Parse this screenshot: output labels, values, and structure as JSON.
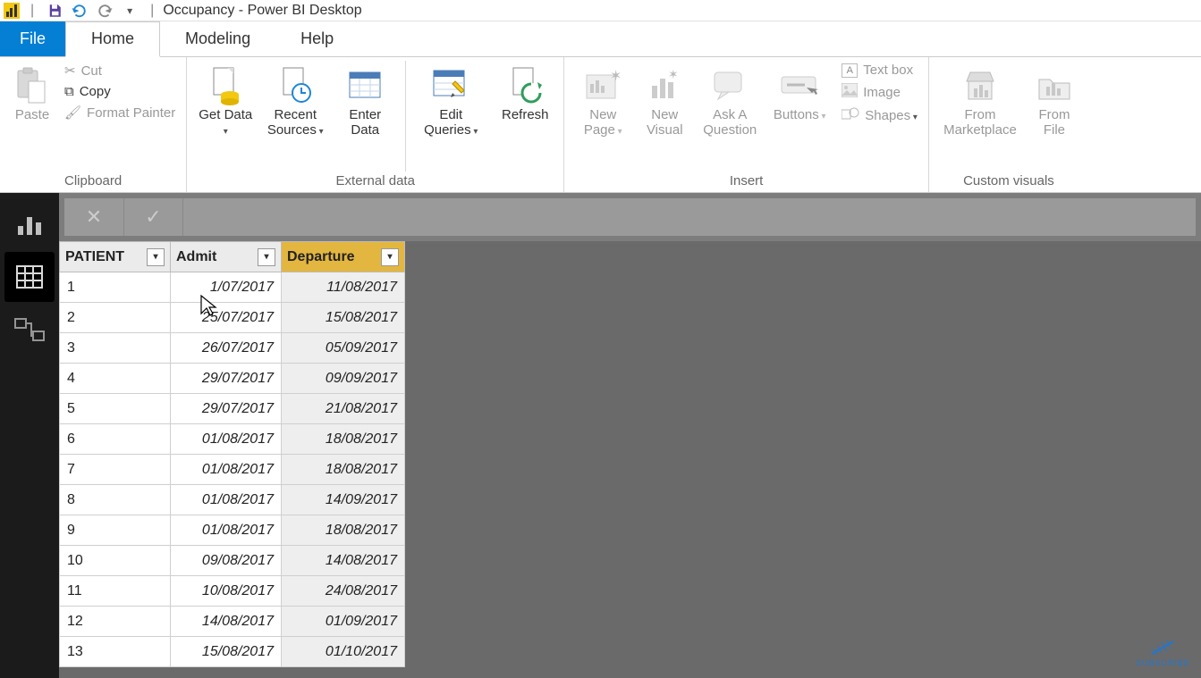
{
  "titlebar": {
    "window_title": "Occupancy - Power BI Desktop"
  },
  "menu": {
    "file": "File",
    "home": "Home",
    "modeling": "Modeling",
    "help": "Help"
  },
  "ribbon": {
    "clipboard": {
      "label": "Clipboard",
      "paste": "Paste",
      "cut": "Cut",
      "copy": "Copy",
      "format_painter": "Format Painter"
    },
    "external_data": {
      "label": "External data",
      "get_data": "Get Data",
      "recent_sources": "Recent Sources",
      "enter_data": "Enter Data",
      "edit_queries": "Edit Queries",
      "refresh": "Refresh"
    },
    "insert": {
      "label": "Insert",
      "new_page": "New Page",
      "new_visual": "New Visual",
      "ask_a_question": "Ask A Question",
      "buttons": "Buttons",
      "text_box": "Text box",
      "image": "Image",
      "shapes": "Shapes"
    },
    "custom_visuals": {
      "label": "Custom visuals",
      "from_marketplace": "From Marketplace",
      "from_file": "From File"
    }
  },
  "table": {
    "columns": {
      "patient": "PATIENT",
      "admit": "Admit",
      "departure": "Departure"
    },
    "rows": [
      {
        "patient": "1",
        "admit": "1/07/2017",
        "departure": "11/08/2017"
      },
      {
        "patient": "2",
        "admit": "25/07/2017",
        "departure": "15/08/2017"
      },
      {
        "patient": "3",
        "admit": "26/07/2017",
        "departure": "05/09/2017"
      },
      {
        "patient": "4",
        "admit": "29/07/2017",
        "departure": "09/09/2017"
      },
      {
        "patient": "5",
        "admit": "29/07/2017",
        "departure": "21/08/2017"
      },
      {
        "patient": "6",
        "admit": "01/08/2017",
        "departure": "18/08/2017"
      },
      {
        "patient": "7",
        "admit": "01/08/2017",
        "departure": "18/08/2017"
      },
      {
        "patient": "8",
        "admit": "01/08/2017",
        "departure": "14/09/2017"
      },
      {
        "patient": "9",
        "admit": "01/08/2017",
        "departure": "18/08/2017"
      },
      {
        "patient": "10",
        "admit": "09/08/2017",
        "departure": "14/08/2017"
      },
      {
        "patient": "11",
        "admit": "10/08/2017",
        "departure": "24/08/2017"
      },
      {
        "patient": "12",
        "admit": "14/08/2017",
        "departure": "01/09/2017"
      },
      {
        "patient": "13",
        "admit": "15/08/2017",
        "departure": "01/10/2017"
      }
    ]
  },
  "subscribe": "SUBSCRIBE"
}
